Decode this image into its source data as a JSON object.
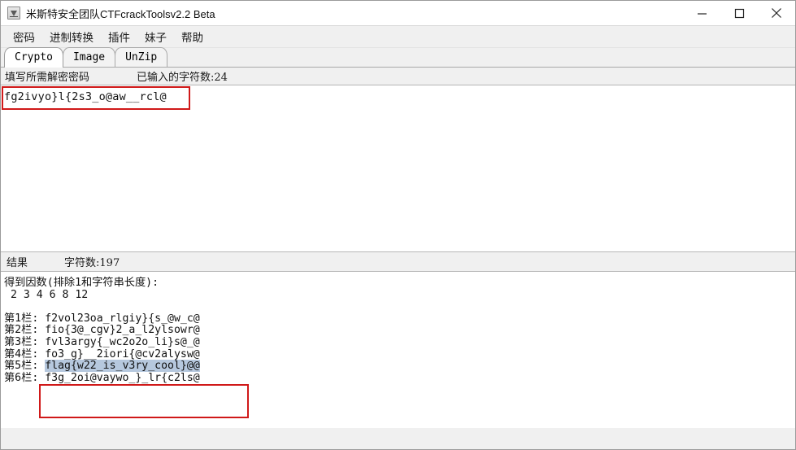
{
  "window": {
    "title": "米斯特安全团队CTFcrackToolsv2.2 Beta",
    "app_icon": "coffee-cup-icon",
    "minimize_label": "—",
    "maximize_label": "□",
    "close_label": "✕"
  },
  "menubar": {
    "items": [
      {
        "label": "密码"
      },
      {
        "label": "进制转换"
      },
      {
        "label": "插件"
      },
      {
        "label": "妹子"
      },
      {
        "label": "帮助"
      }
    ]
  },
  "tabs": [
    {
      "label": "Crypto",
      "active": true
    },
    {
      "label": "Image",
      "active": false
    },
    {
      "label": "UnZip",
      "active": false
    }
  ],
  "input_panel": {
    "prompt_label": "填写所需解密密码",
    "count_label": "已输入的字符数:24",
    "value": "fg2ivyo}l{2s3_o@aw__rcl@",
    "placeholder": ""
  },
  "result_panel": {
    "title_label": "结果",
    "count_label": "字符数:197",
    "lines": [
      "得到因数(排除1和字符串长度):",
      " 2 3 4 6 8 12",
      "",
      "第1栏: f2vol23oa_rlgiy}{s_@w_c@",
      "第2栏: fio{3@_cgv}2_a_l2ylsowr@",
      "第3栏: fvl3argy{_wc2o2o_li}s@_@",
      "第4栏: fo3_g}__2iori{@cv2alysw@",
      "第6栏: f3g_2oi@vaywo_}_lr{c2ls@"
    ],
    "highlighted_row": {
      "prefix": "第5栏: ",
      "text": "flag{w22_is_v3ry_cool}@@"
    }
  },
  "annotations": {
    "input_box_color": "#d01919",
    "flag_box_color": "#d01919"
  }
}
